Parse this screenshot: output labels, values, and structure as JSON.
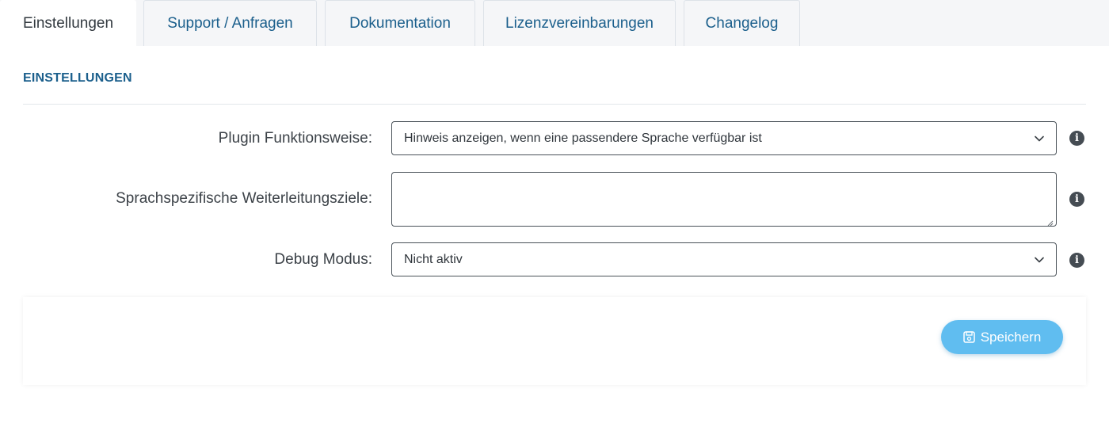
{
  "tabs": [
    {
      "label": "Einstellungen",
      "active": true
    },
    {
      "label": "Support / Anfragen",
      "active": false
    },
    {
      "label": "Dokumentation",
      "active": false
    },
    {
      "label": "Lizenzvereinbarungen",
      "active": false
    },
    {
      "label": "Changelog",
      "active": false
    }
  ],
  "section": {
    "title": "EINSTELLUNGEN"
  },
  "fields": {
    "plugin_mode": {
      "label": "Plugin Funktionsweise:",
      "value": "Hinweis anzeigen, wenn eine passendere Sprache verfügbar ist"
    },
    "redirect_targets": {
      "label": "Sprachspezifische Weiterleitungsziele:",
      "value": ""
    },
    "debug_mode": {
      "label": "Debug Modus:",
      "value": "Nicht aktiv"
    }
  },
  "info_icon_glyph": "i",
  "footer": {
    "save_label": "Speichern"
  },
  "colors": {
    "accent": "#1b5f8c",
    "button": "#60bdf0",
    "tab_bg": "#f5f6f8",
    "info_icon": "#454c53"
  }
}
